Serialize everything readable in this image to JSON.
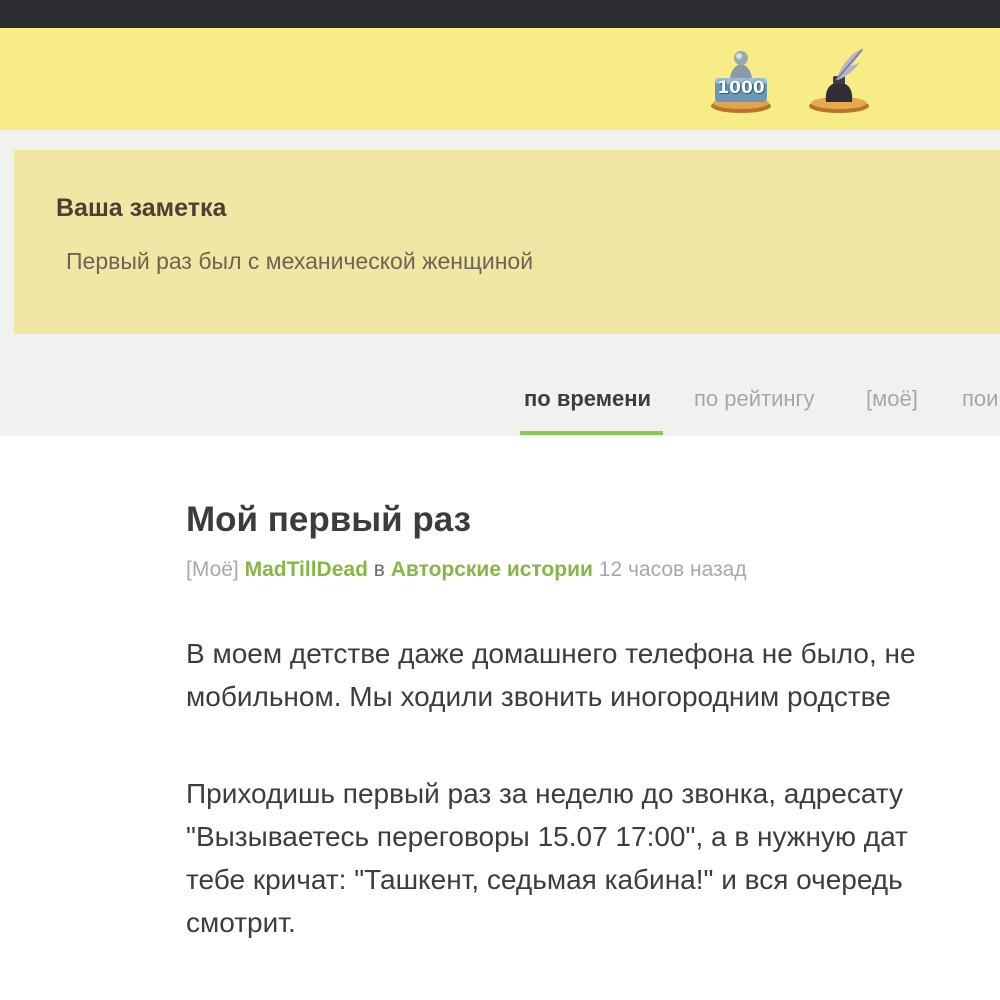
{
  "header": {
    "awards": [
      {
        "icon": "trophy-1000-icon",
        "label": "1000"
      },
      {
        "icon": "inkwell-quill-icon"
      }
    ]
  },
  "note": {
    "title": "Ваша заметка",
    "text": "Первый раз был с механической женщиной"
  },
  "tabs": [
    {
      "label": "по времени",
      "active": true
    },
    {
      "label": "по рейтингу"
    },
    {
      "label": "[моё]"
    },
    {
      "label": "пои"
    }
  ],
  "post": {
    "title": "Мой первый раз",
    "meta": {
      "tag": "[Моё]",
      "author": "MadTillDead",
      "in": "в",
      "community": "Авторские истории",
      "time": "12 часов назад"
    },
    "paragraphs": [
      [
        "В моем детстве даже домашнего телефона не было, не",
        "мобильном. Мы ходили звонить иногородним родстве"
      ],
      [
        "Приходишь первый раз за неделю до звонка, адресату",
        "\"Вызываетесь переговоры 15.07 17:00\", а в нужную дат",
        "тебе кричат: \"Ташкент, седьмая кабина!\" и вся очередь",
        "смотрит."
      ]
    ]
  },
  "colors": {
    "topbar": "#2b2d31",
    "header": "#f7ec86",
    "note_bg": "#f2e6a4",
    "accent_green": "#86b646",
    "tab_underline": "#8ac858"
  }
}
